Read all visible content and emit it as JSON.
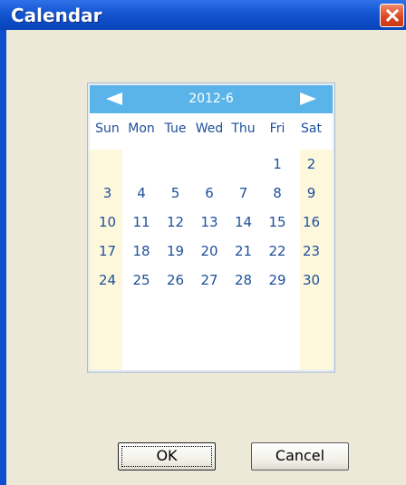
{
  "window": {
    "title": "Calendar"
  },
  "calendar": {
    "month_label": "2012-6",
    "weekdays": [
      "Sun",
      "Mon",
      "Tue",
      "Wed",
      "Thu",
      "Fri",
      "Sat"
    ],
    "weeks": [
      [
        "",
        "",
        "",
        "",
        "",
        "1",
        "2"
      ],
      [
        "3",
        "4",
        "5",
        "6",
        "7",
        "8",
        "9"
      ],
      [
        "10",
        "11",
        "12",
        "13",
        "14",
        "15",
        "16"
      ],
      [
        "17",
        "18",
        "19",
        "20",
        "21",
        "22",
        "23"
      ],
      [
        "24",
        "25",
        "26",
        "27",
        "28",
        "29",
        "30"
      ]
    ]
  },
  "buttons": {
    "ok_label": "OK",
    "cancel_label": "Cancel"
  },
  "icons": {
    "prev": "arrow-left-icon",
    "next": "arrow-right-icon",
    "close": "close-icon"
  },
  "colors": {
    "titlebar": "#0d4bc6",
    "nav_bar": "#5ab4ea",
    "weekend_column": "#fdf7dc",
    "day_text": "#1e4f9a",
    "dialog_background": "#ece9d8"
  }
}
